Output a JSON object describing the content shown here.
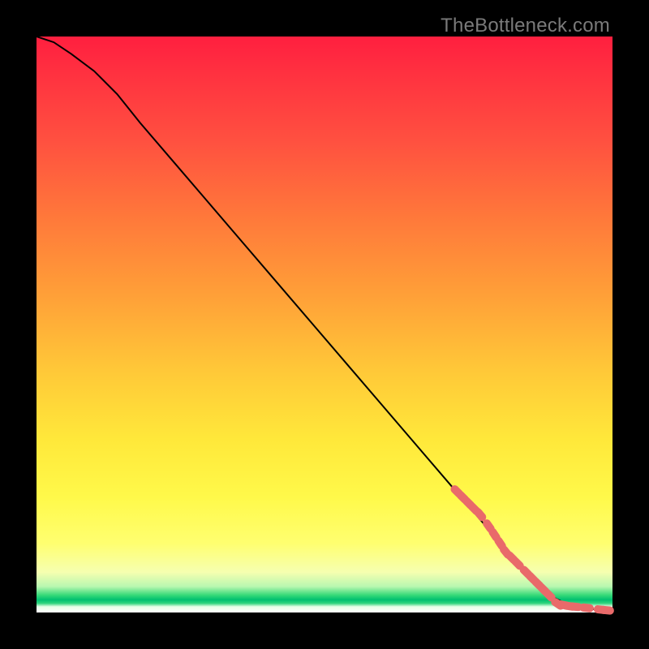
{
  "watermark": "TheBottleneck.com",
  "colors": {
    "background": "#000000",
    "curve": "#000000",
    "marker": "#e96a6a",
    "watermark": "#7a7a7a"
  },
  "chart_data": {
    "type": "line",
    "title": "",
    "xlabel": "",
    "ylabel": "",
    "xlim": [
      0,
      100
    ],
    "ylim": [
      0,
      100
    ],
    "grid": false,
    "legend": false,
    "series": [
      {
        "name": "bottleneck-curve",
        "x": [
          0,
          3,
          6,
          10,
          14,
          18,
          24,
          30,
          36,
          42,
          48,
          54,
          60,
          66,
          72,
          78,
          82,
          85,
          88,
          90,
          92,
          94,
          96,
          98,
          100
        ],
        "y": [
          100,
          99,
          97,
          94,
          90,
          85,
          78,
          71,
          64,
          57,
          50,
          43,
          36,
          29,
          22,
          15,
          10,
          7,
          4,
          2.5,
          1.5,
          1,
          0.7,
          0.4,
          0.2
        ]
      }
    ],
    "markers": {
      "name": "highlighted-points",
      "comment": "salmon capsule markers clustered on the lower-right tail of the curve",
      "points": [
        {
          "x": 73,
          "y": 21
        },
        {
          "x": 74,
          "y": 20
        },
        {
          "x": 75,
          "y": 19
        },
        {
          "x": 76,
          "y": 18
        },
        {
          "x": 77,
          "y": 17
        },
        {
          "x": 78.5,
          "y": 15
        },
        {
          "x": 79.5,
          "y": 13.5
        },
        {
          "x": 80.5,
          "y": 12
        },
        {
          "x": 81.5,
          "y": 10.5
        },
        {
          "x": 82.5,
          "y": 9.5
        },
        {
          "x": 83.5,
          "y": 8.5
        },
        {
          "x": 85,
          "y": 7
        },
        {
          "x": 86,
          "y": 6
        },
        {
          "x": 87,
          "y": 5
        },
        {
          "x": 88,
          "y": 4
        },
        {
          "x": 89,
          "y": 3
        },
        {
          "x": 90.5,
          "y": 1.5
        },
        {
          "x": 91.5,
          "y": 1.3
        },
        {
          "x": 92.5,
          "y": 1.1
        },
        {
          "x": 93.5,
          "y": 1.0
        },
        {
          "x": 95.5,
          "y": 0.8
        },
        {
          "x": 98,
          "y": 0.5
        },
        {
          "x": 99,
          "y": 0.4
        }
      ]
    }
  }
}
